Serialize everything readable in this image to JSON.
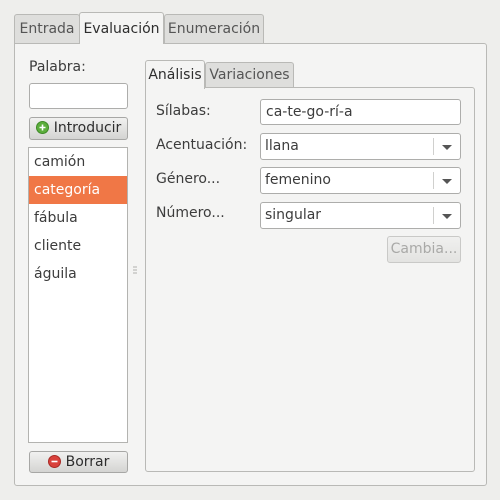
{
  "outer_tabs": [
    "Entrada",
    "Evaluación",
    "Enumeración"
  ],
  "left": {
    "palabra_label": "Palabra:",
    "palabra_value": "",
    "introducir_label": "Introducir",
    "words": [
      "camión",
      "categoría",
      "fábula",
      "cliente",
      "águila"
    ],
    "selected_word": "categoría",
    "borrar_label": "Borrar"
  },
  "inner_tabs": [
    "Análisis",
    "Variaciones"
  ],
  "analysis": {
    "silabas_label": "Sílabas:",
    "silabas_value": "ca-te-go-rí-a",
    "acentuacion_label": "Acentuación:",
    "acentuacion_value": "llana",
    "genero_label": "Género...",
    "genero_value": "femenino",
    "numero_label": "Número...",
    "numero_value": "singular",
    "cambia_label": "Cambia..."
  },
  "colors": {
    "selection": "#f07746",
    "add_icon": "#5cae3c",
    "remove_icon": "#d9413b"
  }
}
